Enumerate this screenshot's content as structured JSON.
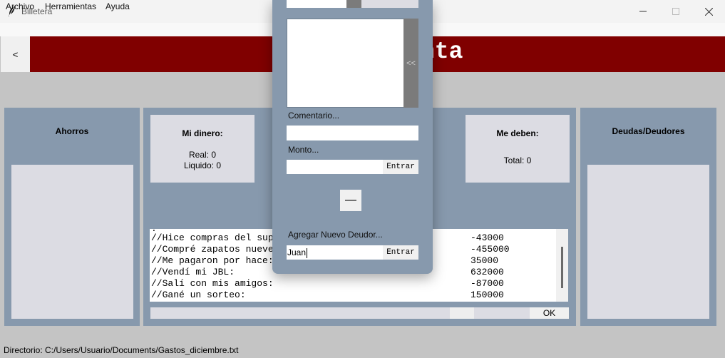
{
  "window": {
    "title": "Billetera",
    "icon": "feather-icon"
  },
  "menu": [
    "Archivo",
    "Herramientas",
    "Ayuda"
  ],
  "header": {
    "back_label": "<",
    "title_visible": "nta",
    "band_color": "#800000"
  },
  "ahorros": {
    "title": "Ahorros"
  },
  "mi_dinero": {
    "title": "Mi dinero:",
    "real": "Real: 0",
    "liquido": "Liquido: 0"
  },
  "me_deben": {
    "title": "Me deben:",
    "total": "Total: 0"
  },
  "deudas": {
    "title": "Deudas/Deudores"
  },
  "log": {
    "partial_top": ".",
    "rows": [
      {
        "text": "//Hice compras del sup",
        "amount": "-43000"
      },
      {
        "text": "//Compré zapatos nueve",
        "amount": "-455000"
      },
      {
        "text": "//Me pagaron por hace:",
        "amount": "35000"
      },
      {
        "text": "//Vendí mi JBL:",
        "amount": "632000"
      },
      {
        "text": "//Salí con mis amigos:",
        "amount": "-87000"
      },
      {
        "text": "//Gané un sorteo:",
        "amount": "150000"
      }
    ]
  },
  "bottom": {
    "ok_label": "OK"
  },
  "status": "Directorio: C:/Users/Usuario/Documents/Gastos_diciembre.txt",
  "dialog": {
    "list_button": "<<",
    "comentario_label": "Comentario...",
    "comentario_value": "",
    "monto_label": "Monto...",
    "monto_value": "",
    "enter_label": "Entrar",
    "minus_label": "—",
    "deudor_label": "Agregar Nuevo Deudor...",
    "deudor_value": "Juan"
  },
  "colors": {
    "panel": "#8799ad",
    "card": "#dcdce3",
    "header": "#800000",
    "background": "#c4c4c4"
  }
}
